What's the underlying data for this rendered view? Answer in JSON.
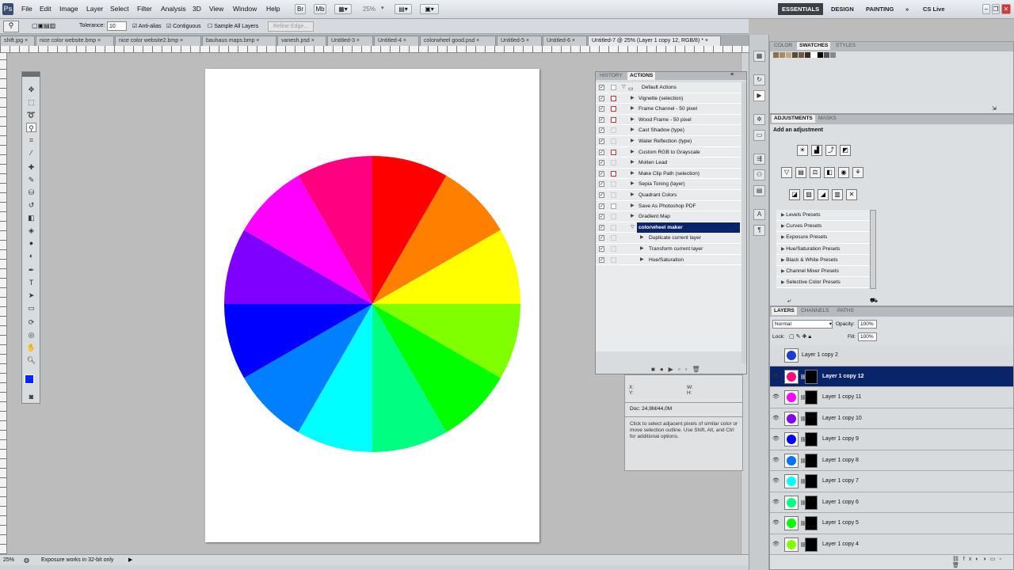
{
  "app": {
    "logo": "Ps"
  },
  "menu": [
    "File",
    "Edit",
    "Image",
    "Layer",
    "Select",
    "Filter",
    "Analysis",
    "3D",
    "View",
    "Window",
    "Help"
  ],
  "appbar": {
    "zoom": "25%"
  },
  "workspaces": {
    "essentials": "ESSENTIALS",
    "design": "DESIGN",
    "painting": "PAINTING",
    "more": "»",
    "cslive": "CS Live"
  },
  "options": {
    "tolerance_label": "Tolerance:",
    "tolerance_value": "10",
    "antialias": "Anti-alias",
    "contiguous": "Contiguous",
    "sample_all": "Sample All Layers",
    "refine_edge": "Refine Edge..."
  },
  "doc_tabs": [
    "shift.jpg",
    "nice color website.bmp",
    "nice color website2.bmp",
    "bauhaus maps.bmp",
    "vanesh.psd",
    "Untitled-3",
    "Untitled-4",
    "colorwheel good.psd",
    "Untitled-5",
    "Untitled-6",
    "Untitled-7 @ 25% (Layer 1 copy 12, RGB/8) *"
  ],
  "status": {
    "zoom": "25%",
    "message": "Exposure works in 32-bit only"
  },
  "actions_panel": {
    "tabs": [
      "HISTORY",
      "ACTIONS"
    ],
    "set_name": "Default Actions",
    "items": [
      {
        "label": "Vignette (selection)",
        "dialog": "red"
      },
      {
        "label": "Frame Channel - 50 pixel",
        "dialog": "red"
      },
      {
        "label": "Wood Frame - 50 pixel",
        "dialog": "red"
      },
      {
        "label": "Cast Shadow (type)",
        "dialog": "none"
      },
      {
        "label": "Water Reflection (type)",
        "dialog": "none"
      },
      {
        "label": "Custom RGB to Grayscale",
        "dialog": "red"
      },
      {
        "label": "Molten Lead",
        "dialog": "none"
      },
      {
        "label": "Make Clip Path (selection)",
        "dialog": "red"
      },
      {
        "label": "Sepia Toning (layer)",
        "dialog": "none"
      },
      {
        "label": "Quadrant Colors",
        "dialog": "none"
      },
      {
        "label": "Save As Photoshop PDF",
        "dialog": "plain"
      },
      {
        "label": "Gradient Map",
        "dialog": "none"
      }
    ],
    "selected_action": "colorwheel maker",
    "steps": [
      "Duplicate current layer",
      "Transform current layer",
      "Hue/Saturation"
    ]
  },
  "info_panel": {
    "row1": "X:\nY:",
    "row2": "W:\nH:",
    "doc": "Doc: 24,9M/44,0M",
    "hint": "Click to select adjacent pixels of similar color or move selection outline.  Use Shift, Alt, and Ctrl for additional options."
  },
  "color_panel": {
    "tabs": [
      "COLOR",
      "SWATCHES",
      "STYLES"
    ],
    "swatches": [
      "#8a6f4c",
      "#a88b63",
      "#c5a880",
      "#5e4a34",
      "#6d5844",
      "#3c2f22",
      "#ffffff",
      "#000000",
      "#555555",
      "#888888"
    ]
  },
  "adjustments": {
    "tabs": [
      "ADJUSTMENTS",
      "MASKS"
    ],
    "title": "Add an adjustment",
    "presets": [
      "Levels Presets",
      "Curves Presets",
      "Exposure Presets",
      "Hue/Saturation Presets",
      "Black & White Presets",
      "Channel Mixer Presets",
      "Selective Color Presets"
    ]
  },
  "layers": {
    "tabs": [
      "LAYERS",
      "CHANNELS",
      "PATHS"
    ],
    "blend_mode": "Normal",
    "opacity_label": "Opacity:",
    "opacity": "100%",
    "lock_label": "Lock:",
    "fill_label": "Fill:",
    "fill": "100%",
    "items": [
      {
        "name": "Layer 1 copy 2",
        "color": "#1a3cd8",
        "visible": false,
        "selected": false
      },
      {
        "name": "Layer 1 copy 12",
        "color": "#ff0a7a",
        "visible": true,
        "selected": true
      },
      {
        "name": "Layer 1 copy 11",
        "color": "#ff00ff",
        "visible": true,
        "selected": false
      },
      {
        "name": "Layer 1 copy 10",
        "color": "#8000ff",
        "visible": true,
        "selected": false
      },
      {
        "name": "Layer 1 copy 9",
        "color": "#0000ff",
        "visible": true,
        "selected": false
      },
      {
        "name": "Layer 1 copy 8",
        "color": "#0070ff",
        "visible": true,
        "selected": false
      },
      {
        "name": "Layer 1 copy 7",
        "color": "#00ffff",
        "visible": true,
        "selected": false
      },
      {
        "name": "Layer 1 copy 6",
        "color": "#00ff80",
        "visible": true,
        "selected": false
      },
      {
        "name": "Layer 1 copy 5",
        "color": "#00ff00",
        "visible": true,
        "selected": false
      },
      {
        "name": "Layer 1 copy 4",
        "color": "#80ff00",
        "visible": true,
        "selected": false
      }
    ]
  },
  "colorwheel": {
    "segments": [
      "#ff0000",
      "#ff8000",
      "#ffff00",
      "#80ff00",
      "#00ff00",
      "#00ff80",
      "#00ffff",
      "#0080ff",
      "#0000ff",
      "#8000ff",
      "#ff00ff",
      "#ff0080"
    ]
  },
  "foreground_color": "#0026ff",
  "background_color": "#000000"
}
